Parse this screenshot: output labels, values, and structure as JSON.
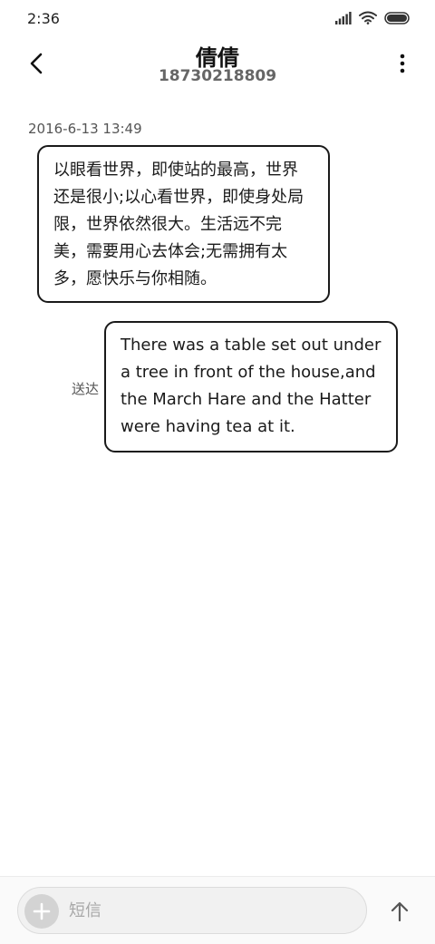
{
  "status_bar": {
    "time": "2:36",
    "icons": [
      "signal-icon",
      "wifi-icon",
      "battery-icon"
    ]
  },
  "header": {
    "contact_name": "倩倩",
    "phone_number": "18730218809",
    "icons": [
      "back-arrow-icon",
      "more-vert-icon"
    ]
  },
  "conversation": {
    "timestamp": "2016-6-13 13:49",
    "messages": [
      {
        "direction": "incoming",
        "text": "以眼看世界，即使站的最高，世界还是很小;以心看世界，即使身处局限，世界依然很大。生活远不完美，需要用心去体会;无需拥有太多，愿快乐与你相随。"
      },
      {
        "direction": "outgoing",
        "text": "There was a table set out under a tree in front of the house,and the March Hare and the Hatter were having tea at it.",
        "status": "送达"
      }
    ]
  },
  "composer": {
    "placeholder": "短信",
    "value": "",
    "icons": [
      "plus-icon",
      "send-arrow-icon"
    ]
  },
  "colors": {
    "bubble_border": "#1a1a1a",
    "background": "#ffffff",
    "secondary_text": "#555555",
    "input_background": "#f1f1f1",
    "add_button": "#d3d3d3"
  }
}
